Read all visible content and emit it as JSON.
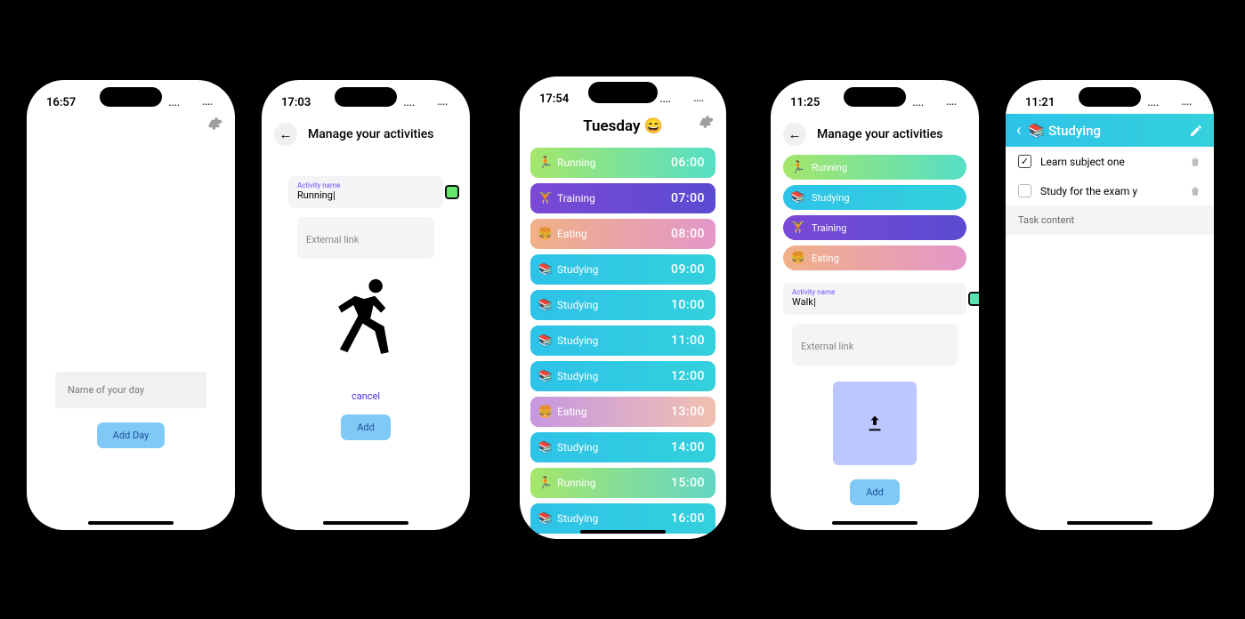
{
  "screen1": {
    "time": "16:57",
    "signal": "....",
    "form": {
      "placeholder": "Name of your day",
      "button": "Add Day"
    }
  },
  "screen2": {
    "time": "17:03",
    "title": "Manage your activities",
    "activity_label": "Activity name",
    "activity_value": "Running",
    "external_link": "External link",
    "swatch_color": "#66e66a",
    "cancel": "cancel",
    "add": "Add"
  },
  "screen3": {
    "time": "17:54",
    "title": "Tuesday 😄",
    "items": [
      {
        "icon": "🏃",
        "label": "Running",
        "time": "06:00",
        "cls": "grad-run"
      },
      {
        "icon": "🏋️",
        "label": "Training",
        "time": "07:00",
        "cls": "grad-train"
      },
      {
        "icon": "🍔",
        "label": "Eating",
        "time": "08:00",
        "cls": "grad-eat"
      },
      {
        "icon": "📚",
        "label": "Studying",
        "time": "09:00",
        "cls": "grad-study"
      },
      {
        "icon": "📚",
        "label": "Studying",
        "time": "10:00",
        "cls": "grad-study"
      },
      {
        "icon": "📚",
        "label": "Studying",
        "time": "11:00",
        "cls": "grad-study"
      },
      {
        "icon": "📚",
        "label": "Studying",
        "time": "12:00",
        "cls": "grad-study"
      },
      {
        "icon": "🍔",
        "label": "Eating",
        "time": "13:00",
        "cls": "grad-eat2"
      },
      {
        "icon": "📚",
        "label": "Studying",
        "time": "14:00",
        "cls": "grad-study"
      },
      {
        "icon": "🏃",
        "label": "Running",
        "time": "15:00",
        "cls": "grad-run2"
      },
      {
        "icon": "📚",
        "label": "Studying",
        "time": "16:00",
        "cls": "grad-study"
      }
    ]
  },
  "screen4": {
    "time": "11:25",
    "title": "Manage your activities",
    "activities": [
      {
        "icon": "🏃",
        "label": "Running",
        "cls": "grad-run"
      },
      {
        "icon": "📚",
        "label": "Studying",
        "cls": "grad-study"
      },
      {
        "icon": "🏋️",
        "label": "Training",
        "cls": "grad-train"
      },
      {
        "icon": "🍔",
        "label": "Eating",
        "cls": "grad-eat"
      }
    ],
    "activity_label": "Activity name",
    "activity_value": "Walk",
    "external_link": "External link",
    "swatch_color": "#57e6b0",
    "add": "Add"
  },
  "screen5": {
    "time": "11:21",
    "header": "Studying",
    "tasks": [
      {
        "label": "Learn subject one",
        "checked": true
      },
      {
        "label": "Study for the exam y",
        "checked": false
      }
    ],
    "new_task": "Task content"
  }
}
